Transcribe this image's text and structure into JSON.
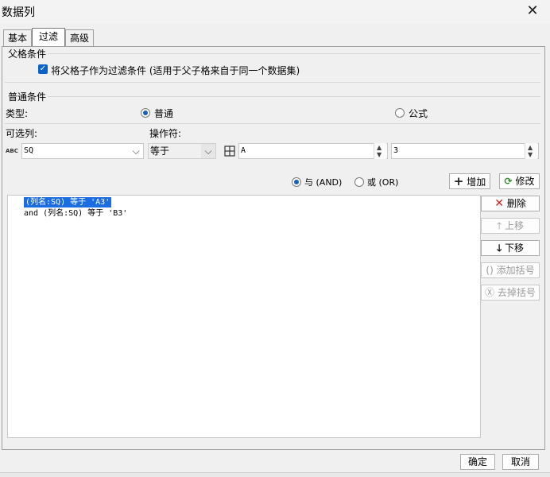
{
  "window": {
    "title": "数据列",
    "close_glyph": "✕"
  },
  "tabs": [
    {
      "label": "基本",
      "active": false
    },
    {
      "label": "过滤",
      "active": true
    },
    {
      "label": "高级",
      "active": false
    }
  ],
  "parent_group": {
    "title": "父格条件",
    "checkbox_label": "将父格子作为过滤条件 (适用于父子格来自于同一个数据集)",
    "checked": true
  },
  "normal_group": {
    "title": "普通条件",
    "type_label": "类型:",
    "type_options": [
      {
        "label": "普通",
        "selected": true
      },
      {
        "label": "公式",
        "selected": false
      }
    ],
    "column_label": "可选列:",
    "operator_label": "操作符:",
    "column_value": "SQ",
    "column_icon_text": "ABC",
    "operator_value": "等于",
    "value_a": "A",
    "value_b": "3"
  },
  "logic": {
    "and_label": "与 (AND)",
    "or_label": "或 (OR)",
    "and_selected": true,
    "add_label": "增加",
    "modify_label": "修改"
  },
  "conditions": [
    {
      "text": "(列名:SQ) 等于 'A3'",
      "selected": true
    },
    {
      "text": "and (列名:SQ) 等于 'B3'",
      "selected": false
    }
  ],
  "side_buttons": [
    {
      "label": "删除",
      "icon": "delete-icon",
      "enabled": true
    },
    {
      "label": "上移",
      "icon": "up-arrow-icon",
      "enabled": false
    },
    {
      "label": "下移",
      "icon": "down-arrow-icon",
      "enabled": true
    },
    {
      "label": "添加括号",
      "icon": "add-bracket-icon",
      "enabled": false
    },
    {
      "label": "去掉括号",
      "icon": "remove-bracket-icon",
      "enabled": false
    }
  ],
  "footer": {
    "ok_label": "确定",
    "cancel_label": "取消"
  },
  "colors": {
    "accent": "#1c6ee0",
    "delete_red": "#d42020",
    "add_green": "#2e8b2e"
  }
}
